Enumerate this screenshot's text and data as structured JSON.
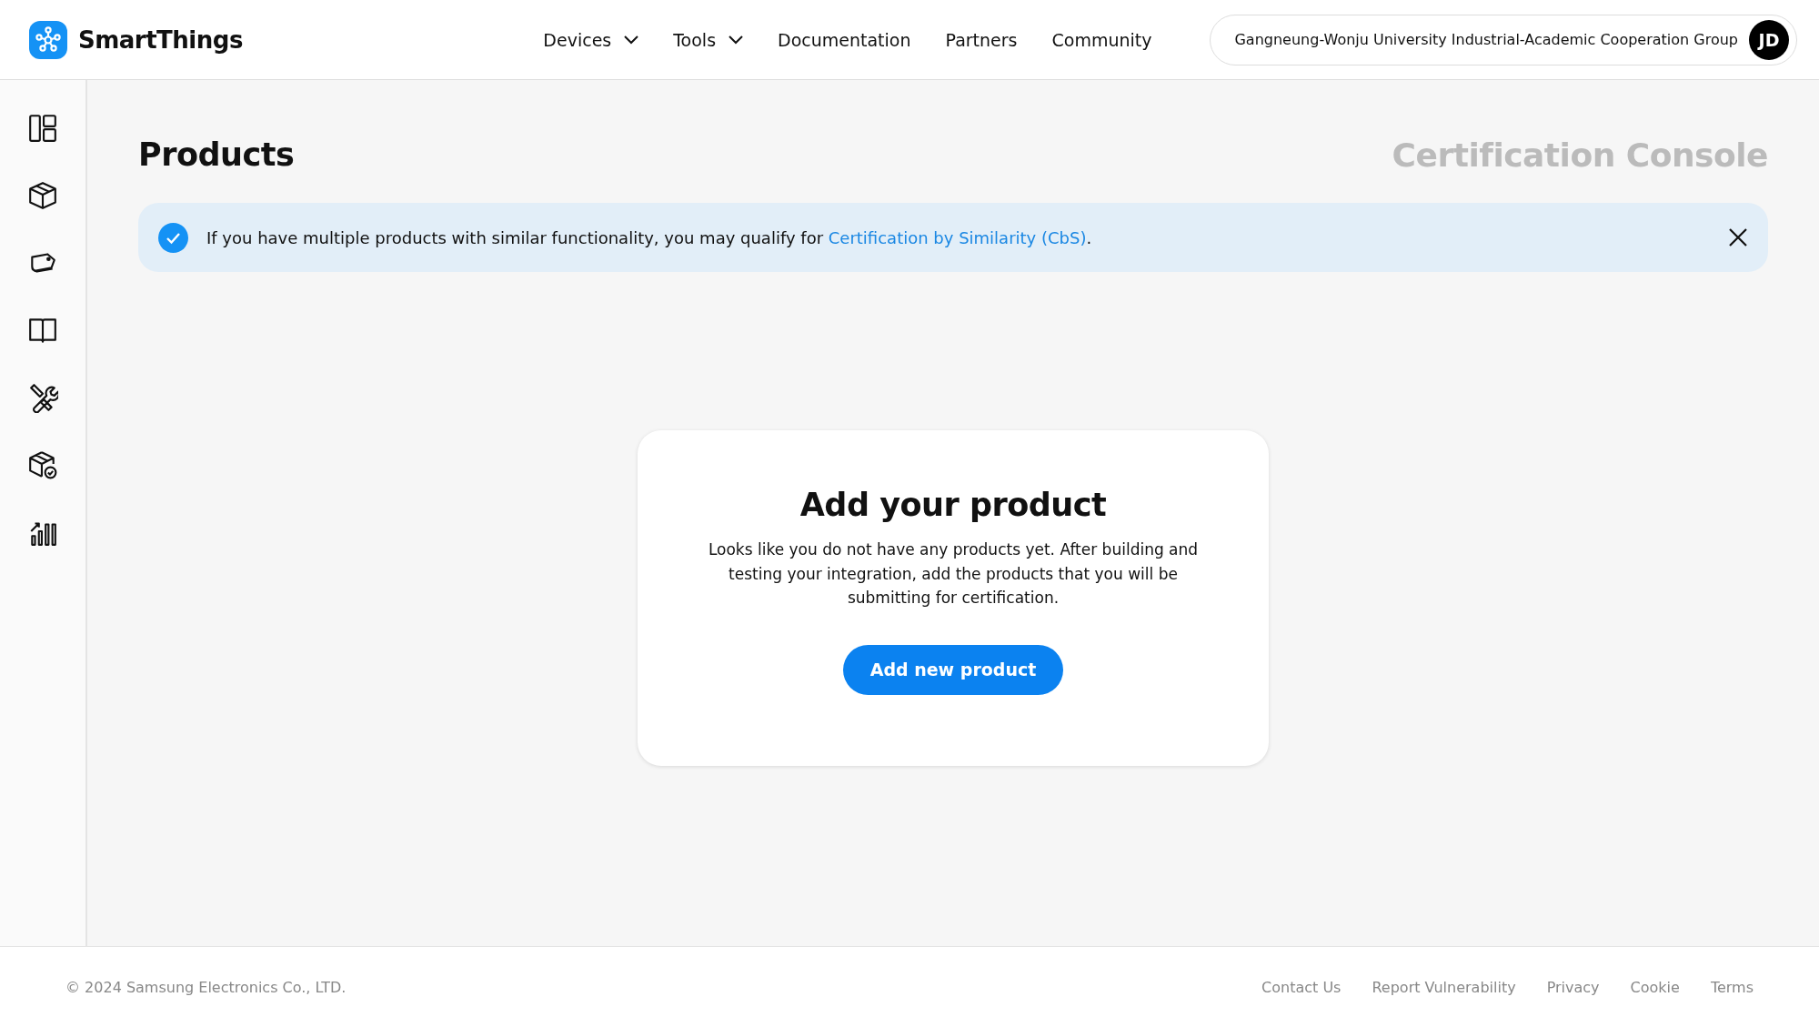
{
  "header": {
    "brand": "SmartThings",
    "nav": [
      {
        "label": "Devices",
        "kind": "dropdown"
      },
      {
        "label": "Tools",
        "kind": "dropdown"
      },
      {
        "label": "Documentation",
        "kind": "link"
      },
      {
        "label": "Partners",
        "kind": "link"
      },
      {
        "label": "Community",
        "kind": "link"
      }
    ],
    "account": {
      "organization": "Gangneung-Wonju University Industrial-Academic Cooperation Group",
      "initials": "JD"
    }
  },
  "sidebar": {
    "items": [
      {
        "kind": "dashboard"
      },
      {
        "kind": "box"
      },
      {
        "kind": "tag"
      },
      {
        "kind": "book"
      },
      {
        "kind": "tools"
      },
      {
        "kind": "box-check"
      },
      {
        "kind": "chart"
      }
    ]
  },
  "page": {
    "title": "Products",
    "console": "Certification Console"
  },
  "banner": {
    "text_before": "If you have multiple products with similar functionality, you may qualify for ",
    "link": "Certification by Similarity (CbS)",
    "text_after": "."
  },
  "empty_state": {
    "title": "Add your product",
    "message": "Looks like you do not have any products yet.  After building and testing your integration, add the products that you will be submitting for certification.",
    "button": "Add new product"
  },
  "footer": {
    "copyright": "© 2024 Samsung Electronics Co., LTD.",
    "links": [
      "Contact Us",
      "Report Vulnerability",
      "Privacy",
      "Cookie",
      "Terms"
    ]
  }
}
